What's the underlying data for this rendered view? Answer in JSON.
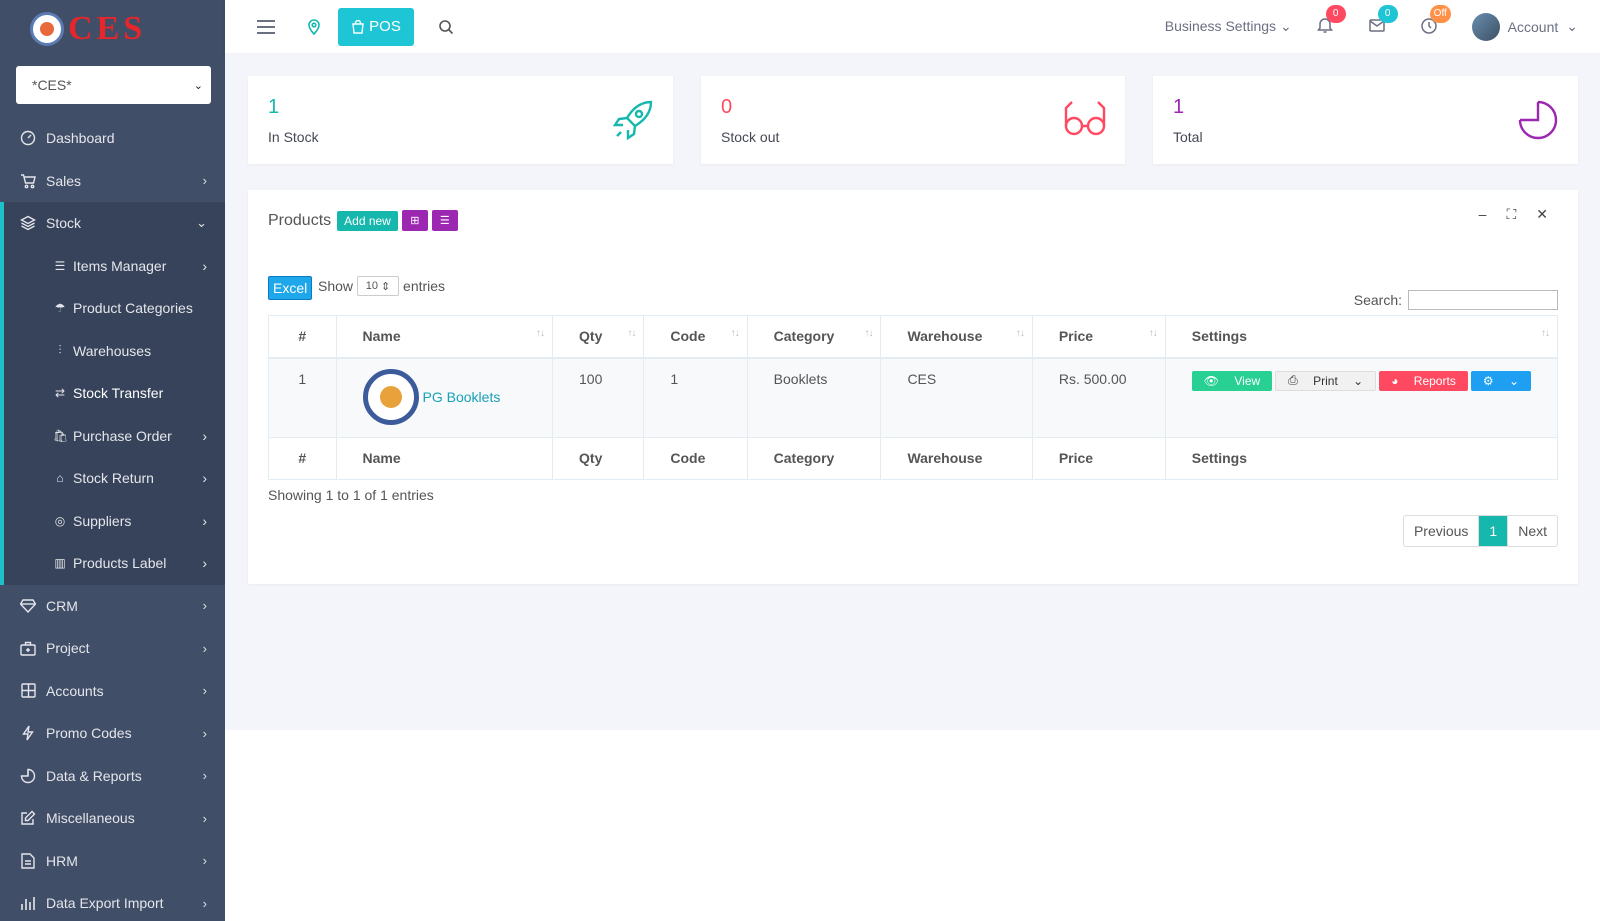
{
  "brand": {
    "logo_text": "CES"
  },
  "branch_select": {
    "value": "*CES*"
  },
  "nav": {
    "dashboard": "Dashboard",
    "sales": "Sales",
    "stock": "Stock",
    "stock_sub": {
      "items_manager": "Items Manager",
      "product_categories": "Product Categories",
      "warehouses": "Warehouses",
      "stock_transfer": "Stock Transfer",
      "purchase_order": "Purchase Order",
      "stock_return": "Stock Return",
      "suppliers": "Suppliers",
      "products_label": "Products Label"
    },
    "crm": "CRM",
    "project": "Project",
    "accounts": "Accounts",
    "promo_codes": "Promo Codes",
    "data_reports": "Data & Reports",
    "miscellaneous": "Miscellaneous",
    "hrm": "HRM",
    "data_export_import": "Data Export Import"
  },
  "header": {
    "pos_label": "POS",
    "business_settings": "Business Settings",
    "notif_count": "0",
    "mail_count": "0",
    "clock_status": "Off",
    "account": "Account"
  },
  "stats": {
    "in_stock": {
      "value": "1",
      "label": "In Stock"
    },
    "stock_out": {
      "value": "0",
      "label": "Stock out"
    },
    "total": {
      "value": "1",
      "label": "Total"
    }
  },
  "products": {
    "title": "Products",
    "add_new": "Add new",
    "excel": "Excel",
    "show_prefix": "Show",
    "show_value": "10",
    "show_suffix": "entries",
    "search_label": "Search:",
    "columns": {
      "num": "#",
      "name": "Name",
      "qty": "Qty",
      "code": "Code",
      "category": "Category",
      "warehouse": "Warehouse",
      "price": "Price",
      "settings": "Settings"
    },
    "rows": [
      {
        "num": "1",
        "name": "PG Booklets",
        "qty": "100",
        "code": "1",
        "category": "Booklets",
        "warehouse": "CES",
        "price": "Rs. 500.00"
      }
    ],
    "actions": {
      "view": "View",
      "print": "Print",
      "reports": "Reports"
    },
    "info": "Showing 1 to 1 of 1 entries",
    "pager": {
      "previous": "Previous",
      "current": "1",
      "next": "Next"
    }
  },
  "colors": {
    "sidebar": "#404e67",
    "accent": "#1ec5d5",
    "teal": "#16b8ad",
    "pink": "#ff4961",
    "purple": "#9c27b0"
  }
}
